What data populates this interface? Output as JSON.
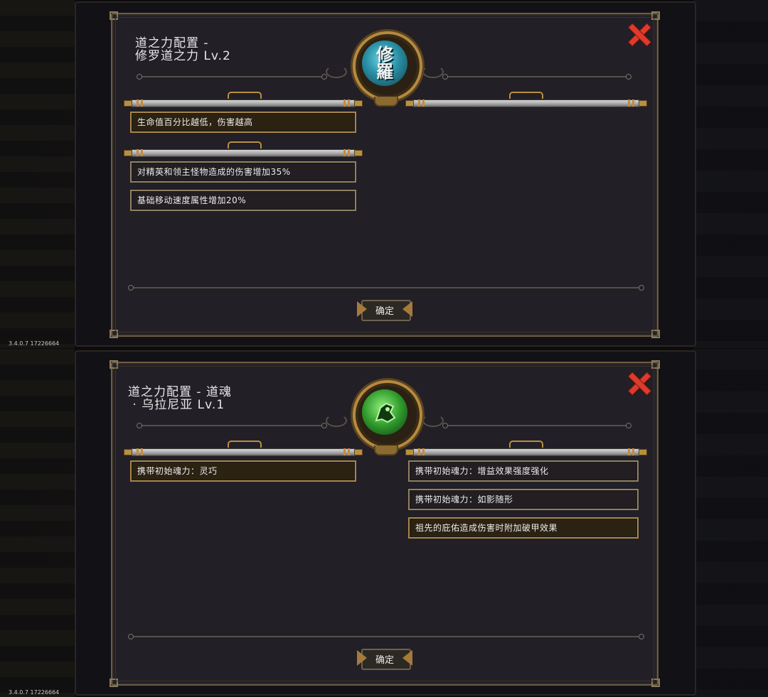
{
  "version_label": "3.4.0.7 17226664",
  "dialogs": [
    {
      "title": "道之力配置 -\n修罗道之力 Lv.2",
      "emblem_glyph": "修\n羅",
      "emblem_color": "#2a8fa5",
      "left_groups": [
        [
          "生命值百分比越低，伤害越高"
        ],
        [
          "对精英和领主怪物造成的伤害增加35%",
          "基础移动速度属性增加20%"
        ]
      ],
      "right_groups": [
        []
      ],
      "highlighted": [
        "生命值百分比越低，伤害越高"
      ],
      "confirm_label": "确定"
    },
    {
      "title": "道之力配置 - 道魂\n · 乌拉尼亚 Lv.1",
      "emblem_glyph": "",
      "emblem_color": "#2f9a2c",
      "left_groups": [
        [
          "携带初始魂力：灵巧"
        ]
      ],
      "right_groups": [
        [
          "携带初始魂力：增益效果强度强化",
          "携带初始魂力：如影随形",
          "祖先的庇佑造成伤害时附加破甲效果"
        ]
      ],
      "highlighted": [
        "携带初始魂力：灵巧",
        "祖先的庇佑造成伤害时附加破甲效果"
      ],
      "confirm_label": "确定"
    }
  ]
}
